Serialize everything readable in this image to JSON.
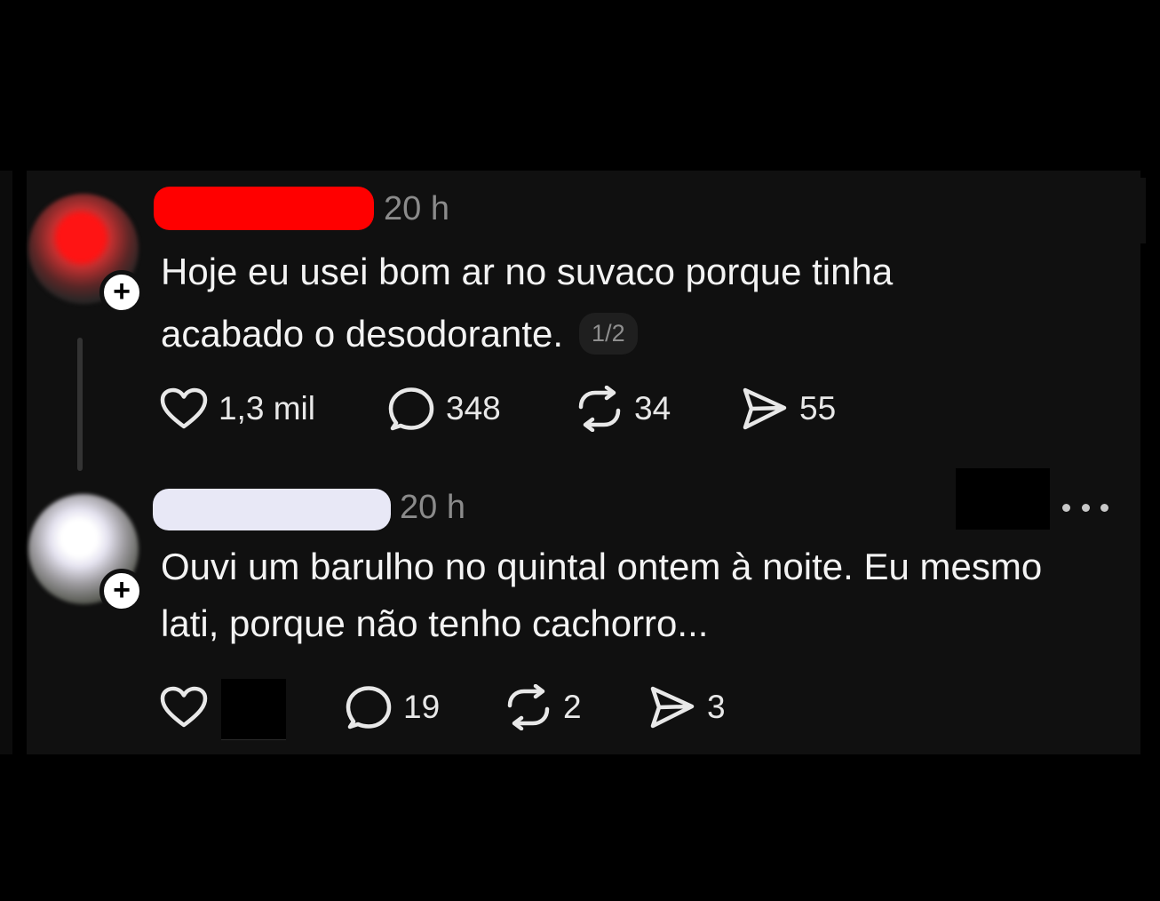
{
  "colors": {
    "background": "#000000",
    "panel": "#101010",
    "text": "#f3f3f3",
    "muted": "#8b8b8b",
    "redaction_red": "#ff0000",
    "redaction_light": "#e8e8f6"
  },
  "posts": [
    {
      "time": "20 h",
      "text": "Hoje eu usei bom ar no suvaco porque tinha acabado o desodorante.",
      "page_indicator": "1/2",
      "likes": "1,3 mil",
      "replies": "348",
      "reposts": "34",
      "shares": "55"
    },
    {
      "time": "20 h",
      "text": "Ouvi um barulho no quintal ontem à noite. Eu mesmo lati, porque não tenho cachorro...",
      "replies": "19",
      "reposts": "2",
      "shares": "3"
    }
  ],
  "icons": {
    "like": "heart-icon",
    "reply": "speech-bubble-icon",
    "repost": "repost-arrows-icon",
    "share": "send-icon",
    "follow": "plus-icon",
    "more": "more-dots-icon"
  }
}
